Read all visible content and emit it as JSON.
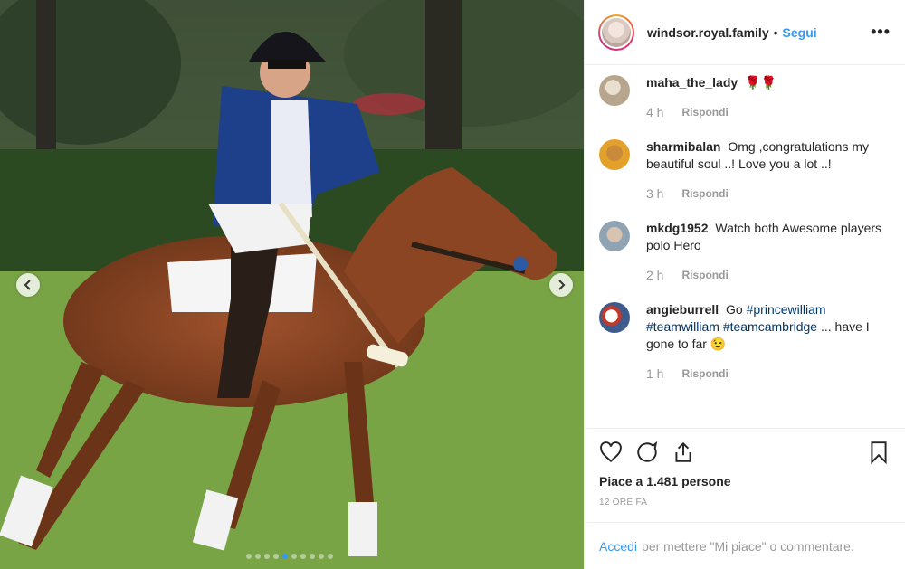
{
  "post": {
    "prev_label": "‹",
    "next_label": "›",
    "slide_count": 10,
    "active_slide": 4
  },
  "header": {
    "username": "windsor.royal.family",
    "separator": "•",
    "follow_label": "Segui",
    "more_label": "•••"
  },
  "comments": [
    {
      "user": "maha_the_lady",
      "text": "🌹🌹",
      "time": "4 h",
      "reply": "Rispondi",
      "avatar_color": "#c9b9a4"
    },
    {
      "user": "sharmibalan",
      "text": "Omg ,congratulations my beautiful soul ..! Love you a lot ..!",
      "time": "3 h",
      "reply": "Rispondi",
      "avatar_color": "#e3a12a"
    },
    {
      "user": "mkdg1952",
      "text": "Watch both Awesome players polo Hero",
      "time": "2 h",
      "reply": "Rispondi",
      "avatar_color": "#8fa3b3"
    },
    {
      "user": "angieburrell",
      "text_prefix": "Go ",
      "tags": [
        "#princewilliam",
        "#teamwilliam",
        "#teamcambridge"
      ],
      "text_suffix": " ... have I gone to far 😉",
      "time": "1 h",
      "reply": "Rispondi",
      "avatar_color": "#3d5b8c"
    }
  ],
  "actions": {
    "likes": "Piace a 1.481 persone",
    "time_ago": "12 ORE FA",
    "icons": [
      "heart-icon",
      "comment-icon",
      "share-icon",
      "bookmark-icon"
    ]
  },
  "login": {
    "link": "Accedi",
    "text": "per mettere \"Mi piace\" o commentare."
  },
  "colors": {
    "accent": "#3897f0",
    "text": "#262626",
    "muted": "#999999",
    "tag": "#003569"
  }
}
